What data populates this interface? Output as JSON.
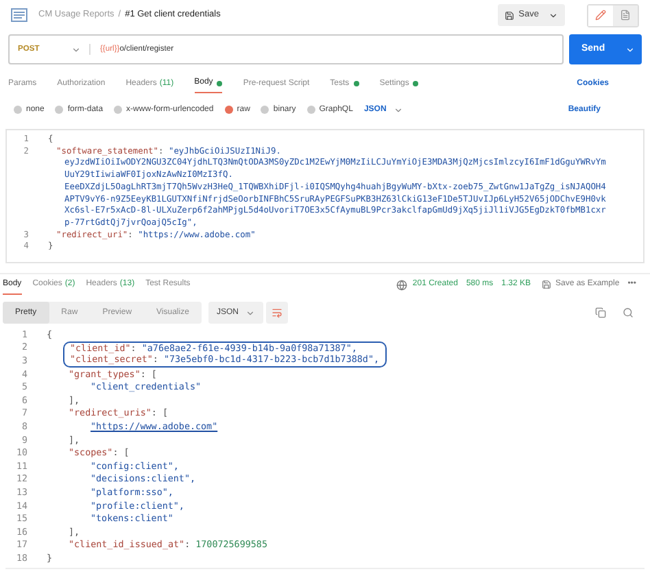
{
  "header": {
    "collection": "CM Usage Reports",
    "separator": "/",
    "title": "#1 Get client credentials",
    "save": "Save",
    "mode_buttons": [
      {
        "kind": "edit",
        "selected": true
      },
      {
        "kind": "docs",
        "selected": false
      }
    ]
  },
  "request": {
    "method": "POST",
    "url_variable": "{{url}}",
    "url_path": "o/client/register",
    "send": "Send"
  },
  "request_tabs": [
    {
      "label": "Params",
      "selected": false
    },
    {
      "label": "Authorization",
      "selected": false
    },
    {
      "label": "Headers",
      "count": "(11)",
      "selected": false
    },
    {
      "label": "Body",
      "dot": true,
      "selected": true
    },
    {
      "label": "Pre-request Script",
      "selected": false
    },
    {
      "label": "Tests",
      "dot": true,
      "selected": false
    },
    {
      "label": "Settings",
      "dot": true,
      "selected": false
    }
  ],
  "cookies_link": "Cookies",
  "body_types": [
    {
      "label": "none",
      "selected": false
    },
    {
      "label": "form-data",
      "selected": false
    },
    {
      "label": "x-www-form-urlencoded",
      "selected": false
    },
    {
      "label": "raw",
      "selected": true
    },
    {
      "label": "binary",
      "selected": false
    },
    {
      "label": "GraphQL",
      "selected": false
    }
  ],
  "body_language": "JSON",
  "beautify": "Beautify",
  "request_body": [
    {
      "number": "1",
      "kind": "brace",
      "tokens": [
        {
          "kind": "punct",
          "text": "{"
        }
      ]
    },
    {
      "number": "2",
      "kind": "field",
      "tokens": [
        {
          "kind": "key",
          "text": "\"software_statement\""
        },
        {
          "kind": "punct",
          "text": ": "
        },
        {
          "kind": "string",
          "text": "\"eyJhbGciOiJSUzI1NiJ9."
        }
      ],
      "wrapped": [
        "eyJzdWIiOiIwODY2NGU3ZC04YjdhLTQ3NmQtODA3MS0yZDc1M2EwYjM0MzIiLCJuYmYiOjE3MDA3MjQzMjcsImlzcyI6ImF1dGguYWRvYm",
        "UuY29tIiwiaWF0IjoxNzAwNzI0MzI3fQ.",
        "EeeDXZdjL5OagLhRT3mjT7Qh5WvzH3HeQ_1TQWBXhiDFjl-i0IQSMQyhg4huahjBgyWuMY-bXtx-zoeb75_ZwtGnw1JaTgZg_isNJAQOH4",
        "APTV9vY6-n9Z5EeyKB1LGUTXNfiNfrjdSeOorbINFBhC5SruRAyPEGFSuPKB3HZ63lCkiG13eF1De5TJUvIJp6LyH52V65jODChvE9H0vk",
        "Xc6sl-E7r5xAcD-8l-ULXuZerp6f2ahMPjgL5d4oUvoriT7OE3x5CfAymuBL9Pcr3akclfapGmUd9jXq5jiJl1iVJG5EgDzkT0fbMB1cxr",
        "p-77rtGdtQj7jvrQoajQ5cIg\","
      ]
    },
    {
      "number": "3",
      "kind": "field",
      "tokens": [
        {
          "kind": "key",
          "text": "\"redirect_uri\""
        },
        {
          "kind": "punct",
          "text": ": "
        },
        {
          "kind": "string",
          "text": "\"https://www.adobe.com\""
        }
      ]
    },
    {
      "number": "4",
      "kind": "brace",
      "tokens": [
        {
          "kind": "punct",
          "text": "}"
        }
      ]
    }
  ],
  "response_tabs": [
    {
      "label": "Body",
      "selected": true
    },
    {
      "label": "Cookies",
      "count": "(2)",
      "selected": false
    },
    {
      "label": "Headers",
      "count": "(13)",
      "selected": false
    },
    {
      "label": "Test Results",
      "selected": false
    }
  ],
  "response_status": {
    "status": "201 Created",
    "time": "580 ms",
    "size": "1.32 KB",
    "save_example": "Save as Example",
    "more": "•••"
  },
  "view_modes": [
    {
      "label": "Pretty",
      "selected": true
    },
    {
      "label": "Raw",
      "selected": false
    },
    {
      "label": "Preview",
      "selected": false
    },
    {
      "label": "Visualize",
      "selected": false
    }
  ],
  "response_language": "JSON",
  "response_body": [
    {
      "number": "1",
      "kind": "brace",
      "highlighted": false,
      "tokens": [
        {
          "kind": "punct",
          "text": "{"
        }
      ]
    },
    {
      "number": "2",
      "kind": "field",
      "highlighted": true,
      "tokens": [
        {
          "kind": "key",
          "text": "\"client_id\""
        },
        {
          "kind": "punct",
          "text": ": "
        },
        {
          "kind": "string",
          "text": "\"a76e8ae2-f61e-4939-b14b-9a0f98a71387\","
        }
      ]
    },
    {
      "number": "3",
      "kind": "field",
      "highlighted": true,
      "tokens": [
        {
          "kind": "key",
          "text": "\"client_secret\""
        },
        {
          "kind": "punct",
          "text": ": "
        },
        {
          "kind": "string",
          "text": "\"73e5ebf0-bc1d-4317-b223-bcb7d1b7388d\","
        }
      ]
    },
    {
      "number": "4",
      "kind": "field",
      "highlighted": false,
      "tokens": [
        {
          "kind": "key",
          "text": "\"grant_types\""
        },
        {
          "kind": "punct",
          "text": ": ["
        }
      ]
    },
    {
      "number": "5",
      "kind": "item",
      "highlighted": false,
      "tokens": [
        {
          "kind": "string",
          "text": "\"client_credentials\""
        }
      ]
    },
    {
      "number": "6",
      "kind": "field",
      "highlighted": false,
      "tokens": [
        {
          "kind": "punct",
          "text": "],"
        }
      ]
    },
    {
      "number": "7",
      "kind": "field",
      "highlighted": false,
      "tokens": [
        {
          "kind": "key",
          "text": "\"redirect_uris\""
        },
        {
          "kind": "punct",
          "text": ": ["
        }
      ]
    },
    {
      "number": "8",
      "kind": "item",
      "highlighted": false,
      "tokens": [
        {
          "kind": "link",
          "text": "\"https://www.adobe.com\""
        }
      ]
    },
    {
      "number": "9",
      "kind": "field",
      "highlighted": false,
      "tokens": [
        {
          "kind": "punct",
          "text": "],"
        }
      ]
    },
    {
      "number": "10",
      "kind": "field",
      "highlighted": false,
      "tokens": [
        {
          "kind": "key",
          "text": "\"scopes\""
        },
        {
          "kind": "punct",
          "text": ": ["
        }
      ]
    },
    {
      "number": "11",
      "kind": "item",
      "highlighted": false,
      "tokens": [
        {
          "kind": "string",
          "text": "\"config:client\","
        }
      ]
    },
    {
      "number": "12",
      "kind": "item",
      "highlighted": false,
      "tokens": [
        {
          "kind": "string",
          "text": "\"decisions:client\","
        }
      ]
    },
    {
      "number": "13",
      "kind": "item",
      "highlighted": false,
      "tokens": [
        {
          "kind": "string",
          "text": "\"platform:sso\","
        }
      ]
    },
    {
      "number": "14",
      "kind": "item",
      "highlighted": false,
      "tokens": [
        {
          "kind": "string",
          "text": "\"profile:client\","
        }
      ]
    },
    {
      "number": "15",
      "kind": "item",
      "highlighted": false,
      "tokens": [
        {
          "kind": "string",
          "text": "\"tokens:client\""
        }
      ]
    },
    {
      "number": "16",
      "kind": "field",
      "highlighted": false,
      "tokens": [
        {
          "kind": "punct",
          "text": "],"
        }
      ]
    },
    {
      "number": "17",
      "kind": "field",
      "highlighted": false,
      "tokens": [
        {
          "kind": "key",
          "text": "\"client_id_issued_at\""
        },
        {
          "kind": "punct",
          "text": ": "
        },
        {
          "kind": "number",
          "text": "1700725699585"
        }
      ]
    },
    {
      "number": "18",
      "kind": "brace",
      "highlighted": false,
      "tokens": [
        {
          "kind": "punct",
          "text": "}"
        }
      ]
    }
  ]
}
